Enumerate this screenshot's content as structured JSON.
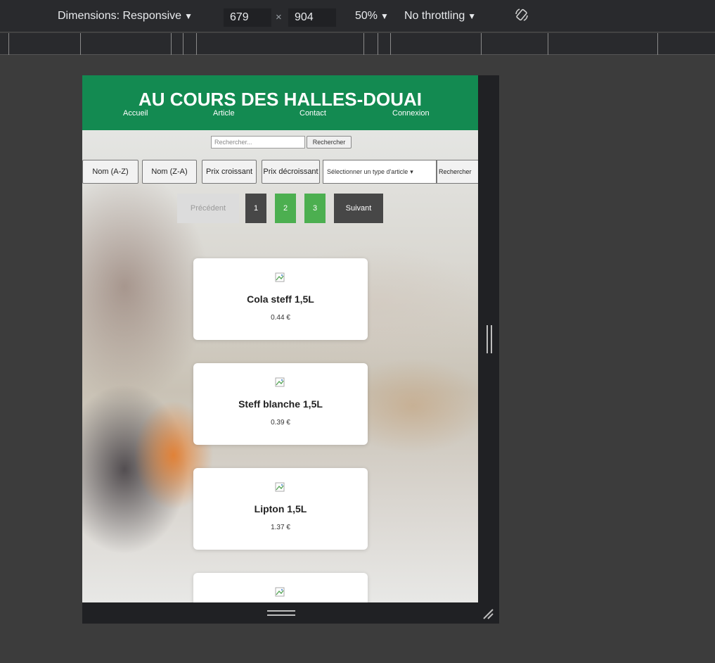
{
  "devtools": {
    "dimensions_label": "Dimensions: Responsive",
    "width_value": "679",
    "times_sign": "×",
    "height_value": "904",
    "zoom": "50%",
    "throttling": "No throttling"
  },
  "site": {
    "title": "AU COURS DES HALLES-DOUAI",
    "nav": [
      "Accueil",
      "Article",
      "Contact",
      "Connexion"
    ],
    "search": {
      "placeholder": "Rechercher...",
      "button": "Rechercher"
    },
    "sort_buttons": [
      "Nom (A-Z)",
      "Nom (Z-A)",
      "Prix croissant",
      "Prix décroissant"
    ],
    "type_select": "Sélectionner un type d'article",
    "filter_button": "Rechercher",
    "pagination": {
      "prev": "Précédent",
      "pages": [
        "1",
        "2",
        "3"
      ],
      "next": "Suivant"
    },
    "products": [
      {
        "name": "Cola steff 1,5L",
        "price": "0.44 €"
      },
      {
        "name": "Steff blanche 1,5L",
        "price": "0.39 €"
      },
      {
        "name": "Lipton 1,5L",
        "price": "1.37 €"
      }
    ]
  }
}
